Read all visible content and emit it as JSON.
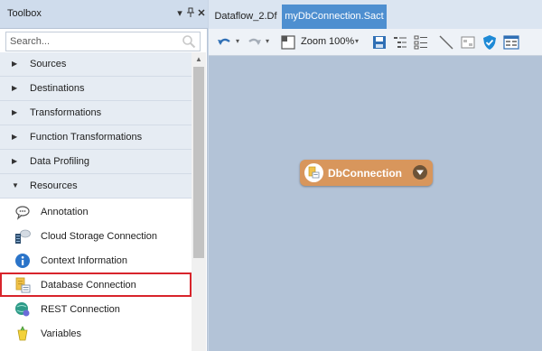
{
  "toolbox": {
    "title": "Toolbox",
    "search_placeholder": "Search...",
    "categories": [
      {
        "label": "Sources"
      },
      {
        "label": "Destinations"
      },
      {
        "label": "Transformations"
      },
      {
        "label": "Function Transformations"
      },
      {
        "label": "Data Profiling"
      },
      {
        "label": "Resources"
      }
    ],
    "items": [
      {
        "label": "Annotation",
        "icon": "annotation-icon"
      },
      {
        "label": "Cloud Storage Connection",
        "icon": "cloud-storage-icon"
      },
      {
        "label": "Context Information",
        "icon": "info-icon"
      },
      {
        "label": "Database Connection",
        "icon": "database-connection-icon",
        "selected": true
      },
      {
        "label": "REST Connection",
        "icon": "rest-globe-icon"
      },
      {
        "label": "Variables",
        "icon": "variables-icon"
      }
    ]
  },
  "tabs": [
    {
      "label": "Dataflow_2.Df",
      "active": false
    },
    {
      "label": "myDbConnection.Sact",
      "active": true
    }
  ],
  "toolbar": {
    "zoom_label": "Zoom",
    "zoom_value": "100%"
  },
  "canvas": {
    "node_label": "DbConnection"
  },
  "colors": {
    "panel_header": "#cfdcec",
    "active_tab": "#4e8fd0",
    "canvas": "#b3c3d7",
    "node": "#d8965c",
    "highlight": "#d8242b"
  }
}
